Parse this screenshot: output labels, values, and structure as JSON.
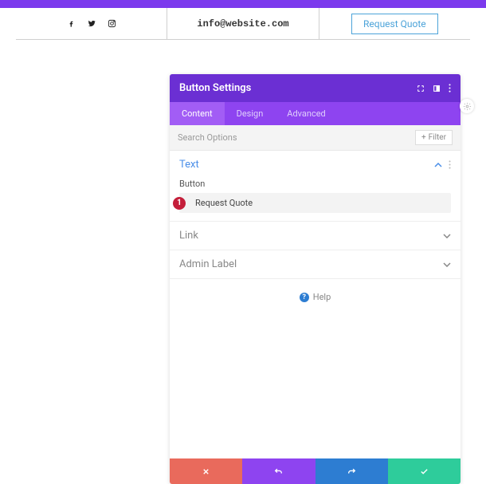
{
  "header": {
    "email": "info@website.com",
    "cta_label": "Request Quote",
    "social": {
      "facebook": "facebook-icon",
      "twitter": "twitter-icon",
      "instagram": "instagram-icon"
    }
  },
  "modal": {
    "title": "Button Settings",
    "tabs": {
      "content": "Content",
      "design": "Design",
      "advanced": "Advanced"
    },
    "search_placeholder": "Search Options",
    "filter_label": "Filter",
    "sections": {
      "text": {
        "title": "Text",
        "field_label": "Button",
        "field_value": "Request Quote",
        "badge": "1"
      },
      "link": {
        "title": "Link"
      },
      "admin": {
        "title": "Admin Label"
      }
    },
    "help_label": "Help"
  }
}
